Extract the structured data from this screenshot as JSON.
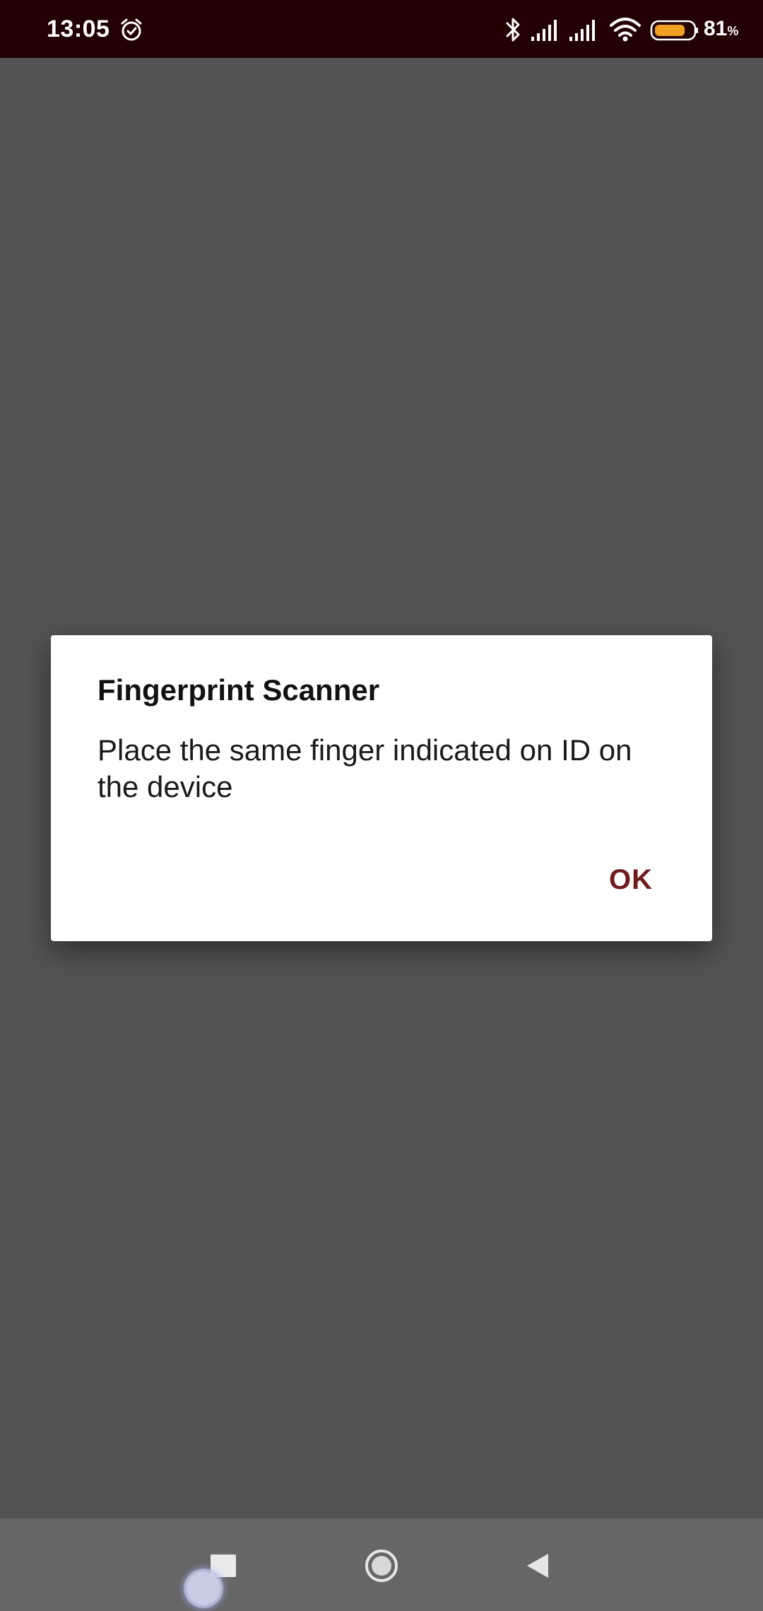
{
  "status_bar": {
    "time": "13:05",
    "battery_value": "81",
    "battery_unit": "%",
    "icons": [
      "alarm-icon",
      "bluetooth-icon",
      "signal-icon",
      "signal-icon",
      "wifi-icon",
      "battery-icon"
    ],
    "battery_level": 0.81,
    "battery_color": "#f0a020",
    "background_color": "#230102"
  },
  "dialog": {
    "title": "Fingerprint Scanner",
    "message": "Place the same finger indicated on ID on the device",
    "ok_label": "OK",
    "accent_color": "#701c1f"
  },
  "nav_bar": {
    "buttons": [
      "recents-button",
      "home-button",
      "back-button"
    ]
  }
}
